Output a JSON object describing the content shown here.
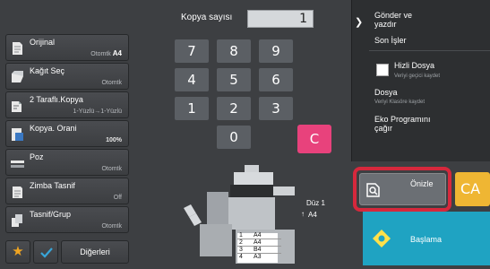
{
  "functions": [
    {
      "label": "Orijinal",
      "value": "Otomtk",
      "value_extra": "A4",
      "icon": "document-icon"
    },
    {
      "label": "Kağıt Seç",
      "value": "Otomtk",
      "icon": "paper-icon"
    },
    {
      "label": "2 Taraflı.Kopya",
      "value": "1-Yüzlü→1-Yüzlü",
      "icon": "duplex-icon"
    },
    {
      "label": "Kopya. Orani",
      "value": "100%",
      "icon": "ratio-icon"
    },
    {
      "label": "Poz",
      "value": "Otomtk",
      "icon": "exposure-icon"
    },
    {
      "label": "Zimba Tasnif",
      "value": "Off",
      "icon": "staple-icon"
    },
    {
      "label": "Tasnif/Grup",
      "value": "Otomtk",
      "icon": "sort-icon"
    }
  ],
  "bottom": {
    "others_label": "Diğerleri"
  },
  "copies": {
    "label": "Kopya sayısı",
    "value": "1"
  },
  "keypad": {
    "keys": [
      "7",
      "8",
      "9",
      "4",
      "5",
      "6",
      "1",
      "2",
      "3",
      "0"
    ],
    "clear": "C"
  },
  "side_panel": {
    "send_print": "Gönder ve\nyazdır",
    "recent_jobs": "Son İşler",
    "quick_file": "Hizli Dosya",
    "quick_file_sub": "Veriyi geçici kaydet",
    "file": "Dosya",
    "file_sub": "Veriyi Klasöre kaydet",
    "eco": "Eko Programını\nçağır"
  },
  "machine": {
    "output_label": "Düz 1",
    "output_size": "A4",
    "trays": [
      {
        "num": "1",
        "size": "A4"
      },
      {
        "num": "2",
        "size": "A4"
      },
      {
        "num": "3",
        "size": "B4"
      },
      {
        "num": "4",
        "size": "A3"
      }
    ]
  },
  "preview": {
    "label": "Önizle"
  },
  "ca_label": "CA",
  "start_label": "Başlama",
  "colors": {
    "background": "#3d3f42",
    "highlight": "#d6283c",
    "clear": "#e8427c",
    "ca": "#efb633",
    "start": "#1fa3c2"
  }
}
